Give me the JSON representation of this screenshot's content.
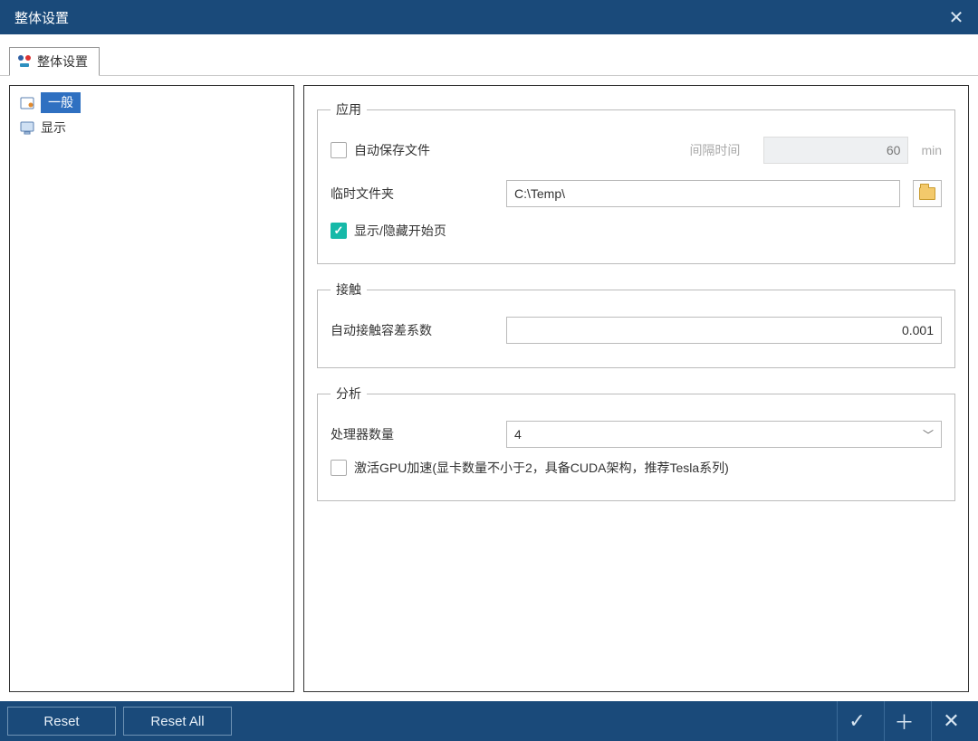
{
  "title": "整体设置",
  "tab": {
    "label": "整体设置"
  },
  "sidebar": {
    "items": [
      {
        "label": "一般"
      },
      {
        "label": "显示"
      }
    ]
  },
  "groups": {
    "app": {
      "legend": "应用",
      "autosave_label": "自动保存文件",
      "interval_label": "间隔时间",
      "interval_value": "60",
      "interval_unit": "min",
      "tempdir_label": "临时文件夹",
      "tempdir_value": "C:\\Temp\\",
      "showhome_label": "显示/隐藏开始页"
    },
    "contact": {
      "legend": "接触",
      "tol_label": "自动接触容差系数",
      "tol_value": "0.001"
    },
    "analysis": {
      "legend": "分析",
      "ncpu_label": "处理器数量",
      "ncpu_value": "4",
      "gpu_label": "激活GPU加速(显卡数量不小于2，具备CUDA架构，推荐Tesla系列)"
    }
  },
  "footer": {
    "reset": "Reset",
    "reset_all": "Reset All"
  }
}
